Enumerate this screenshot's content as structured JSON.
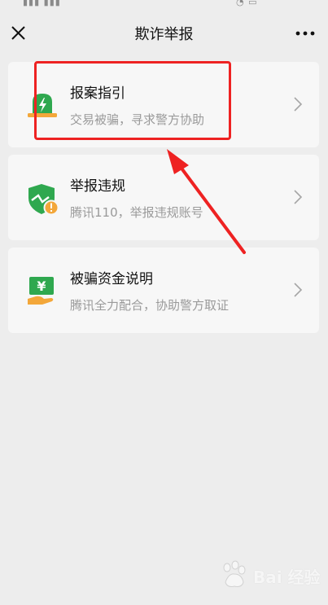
{
  "nav": {
    "title": "欺诈举报",
    "close_icon": "close-icon",
    "more_icon": "more-icon"
  },
  "cards": [
    {
      "title": "报案指引",
      "subtitle": "交易被骗，寻求警方协助",
      "icon": "police-light-icon"
    },
    {
      "title": "举报违规",
      "subtitle": "腾讯110，举报违规账号",
      "icon": "broken-shield-warning-icon"
    },
    {
      "title": "被骗资金说明",
      "subtitle": "腾讯全力配合，协助警方取证",
      "icon": "yuan-money-icon"
    }
  ],
  "colors": {
    "accent_green": "#2fa84f",
    "highlight_red": "#ee2222",
    "warning_orange": "#f3a73a"
  },
  "watermark": {
    "text": "Bai 经验",
    "icon": "paw-logo-icon"
  }
}
